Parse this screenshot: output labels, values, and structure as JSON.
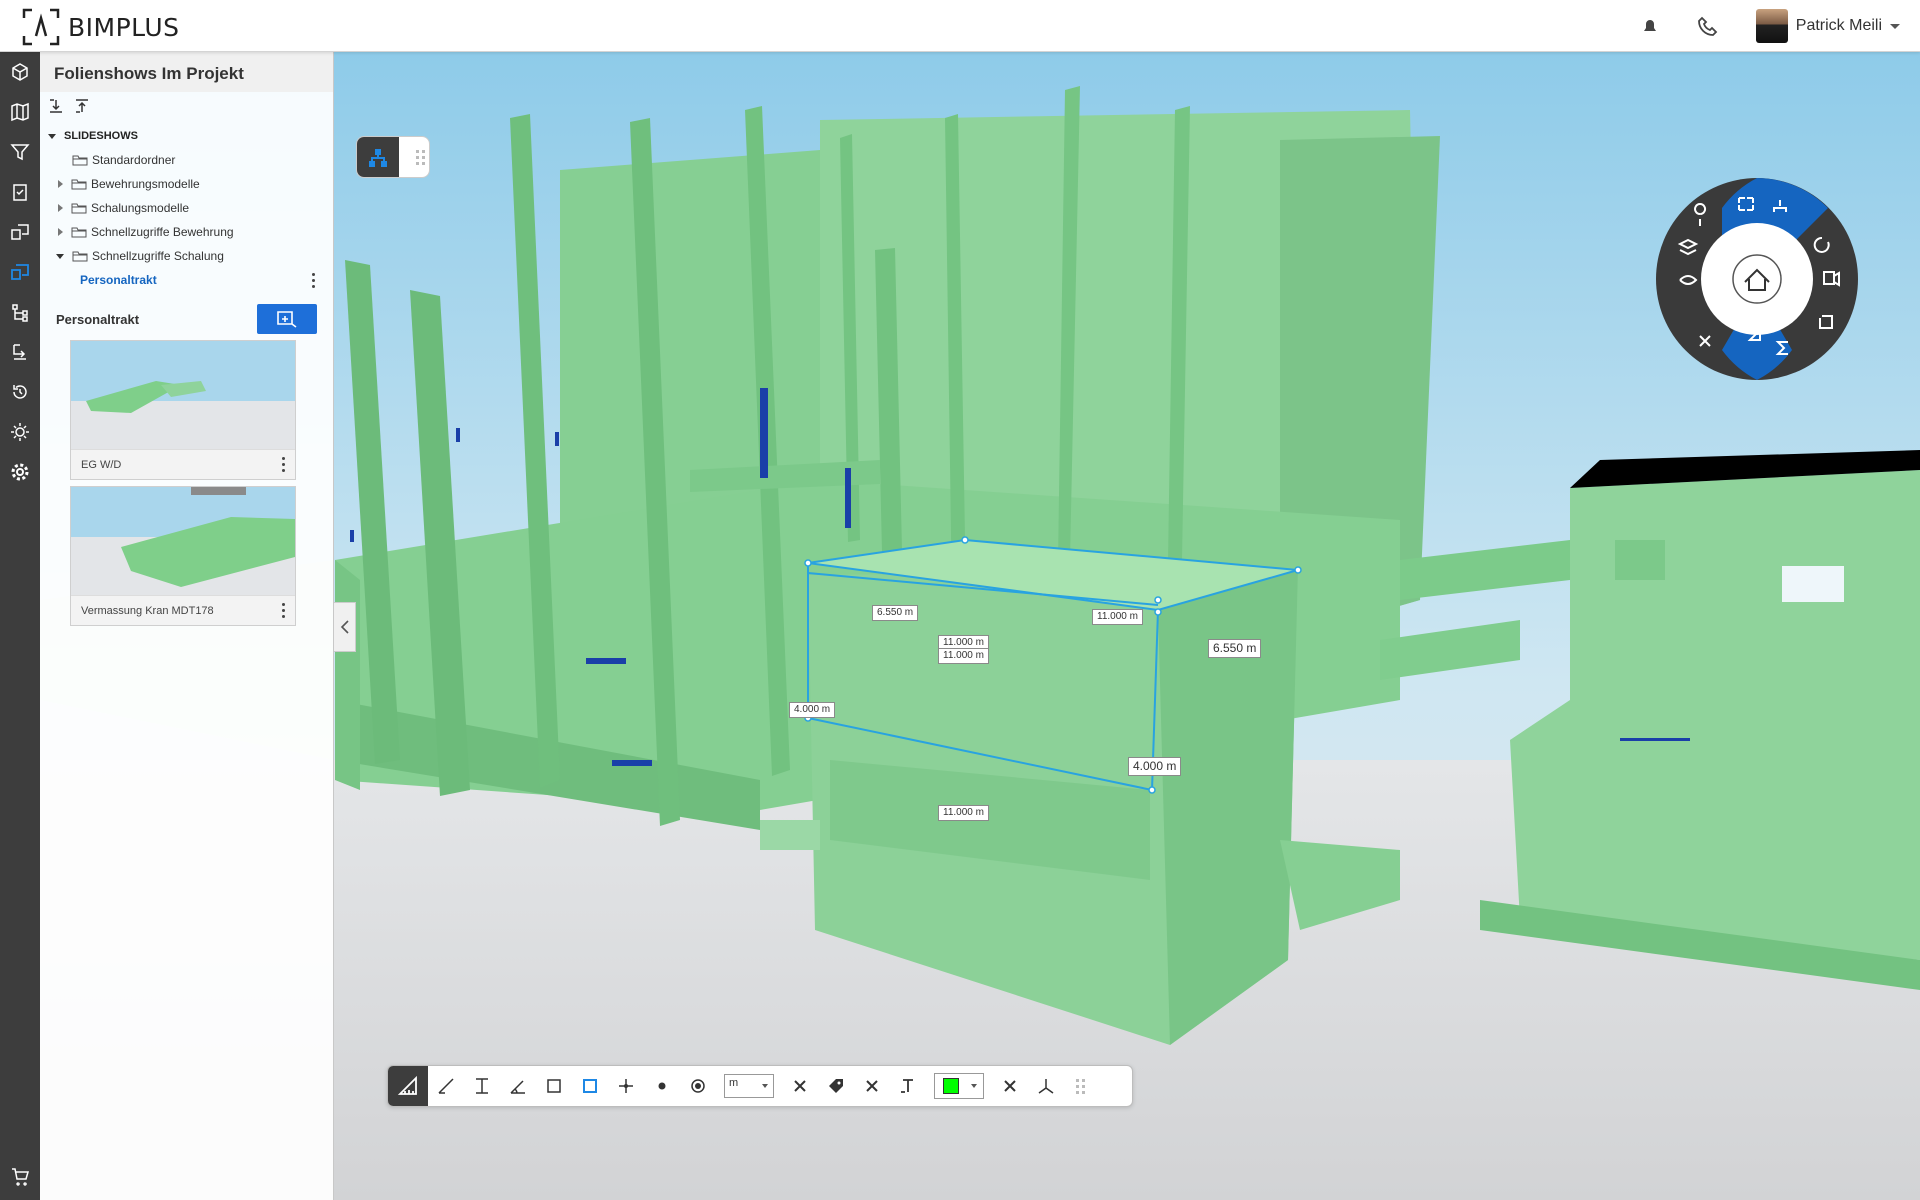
{
  "app": {
    "brand": "BIMPLUS"
  },
  "header": {
    "user_name": "Patrick Meili"
  },
  "panel": {
    "title": "Folienshows Im Projekt",
    "tree_root": "SLIDESHOWS",
    "folders": [
      {
        "label": "Standardordner"
      },
      {
        "label": "Bewehrungsmodelle"
      },
      {
        "label": "Schalungsmodelle"
      },
      {
        "label": "Schnellzugriffe Bewehrung"
      },
      {
        "label": "Schnellzugriffe Schalung"
      }
    ],
    "selected_item": "Personaltrakt",
    "section_title": "Personaltrakt",
    "slides": [
      {
        "caption": "EG W/D"
      },
      {
        "caption": "Vermassung Kran MDT178"
      }
    ]
  },
  "measurements": {
    "top_left": "6.550 m",
    "top_right": "11.000 m",
    "mid_a": "11.000 m",
    "mid_b": "11.000 m",
    "right_depth": "6.550 m",
    "left_height": "4.000 m",
    "right_height": "4.000 m",
    "bottom": "11.000 m"
  },
  "toolbar": {
    "unit": "m",
    "color": "#00ff00"
  },
  "colors": {
    "accent": "#1e6fd9",
    "model": "#7fcf8a",
    "sky": "#a9d7ec",
    "measure": "#29a3e0"
  }
}
